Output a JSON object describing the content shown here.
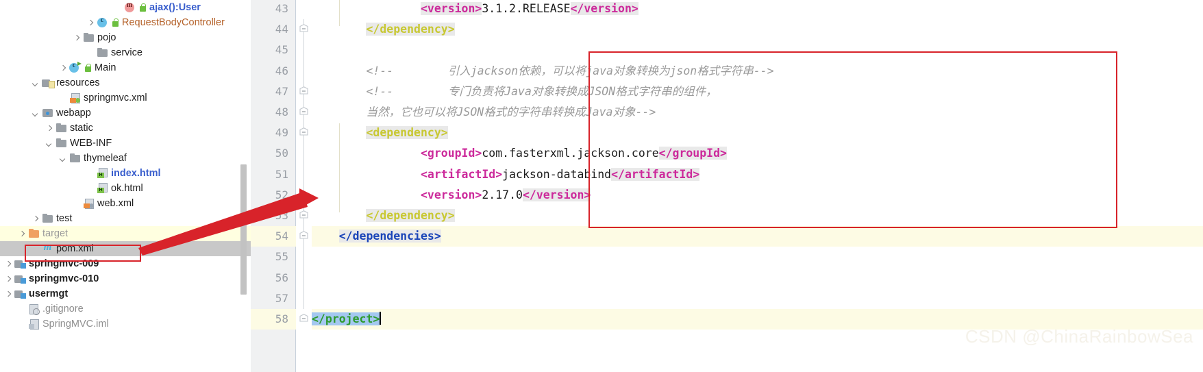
{
  "project_tree": {
    "items": [
      {
        "indent": 9,
        "chevron": "none",
        "icon": "method",
        "lock": true,
        "label": "ajax():User",
        "style": "blue"
      },
      {
        "indent": 7,
        "chevron": "right",
        "icon": "cls",
        "lock": true,
        "label": "RequestBodyController",
        "style": "orange"
      },
      {
        "indent": 6,
        "chevron": "right",
        "icon": "folder",
        "lock": false,
        "label": "pojo",
        "style": "plain"
      },
      {
        "indent": 7,
        "chevron": "none",
        "icon": "folder",
        "lock": false,
        "label": "service",
        "style": "plain"
      },
      {
        "indent": 5,
        "chevron": "right",
        "icon": "clsrun",
        "lock": true,
        "label": "Main",
        "style": "plain"
      },
      {
        "indent": 3,
        "chevron": "down",
        "icon": "folder-res",
        "lock": false,
        "label": "resources",
        "style": "plain"
      },
      {
        "indent": 5,
        "chevron": "none",
        "icon": "xml",
        "lock": false,
        "label": "springmvc.xml",
        "style": "plain"
      },
      {
        "indent": 3,
        "chevron": "down",
        "icon": "webapp",
        "lock": false,
        "label": "webapp",
        "style": "plain"
      },
      {
        "indent": 4,
        "chevron": "right",
        "icon": "folder",
        "lock": false,
        "label": "static",
        "style": "plain"
      },
      {
        "indent": 4,
        "chevron": "down",
        "icon": "folder",
        "lock": false,
        "label": "WEB-INF",
        "style": "plain"
      },
      {
        "indent": 5,
        "chevron": "down",
        "icon": "folder",
        "lock": false,
        "label": "thymeleaf",
        "style": "plain"
      },
      {
        "indent": 7,
        "chevron": "none",
        "icon": "html",
        "lock": false,
        "label": "index.html",
        "style": "blue"
      },
      {
        "indent": 7,
        "chevron": "none",
        "icon": "html",
        "lock": false,
        "label": "ok.html",
        "style": "plain"
      },
      {
        "indent": 6,
        "chevron": "none",
        "icon": "xmlgray",
        "lock": false,
        "label": "web.xml",
        "style": "plain"
      },
      {
        "indent": 3,
        "chevron": "right",
        "icon": "folder",
        "lock": false,
        "label": "test",
        "style": "plain"
      },
      {
        "indent": 2,
        "chevron": "right",
        "icon": "folder-orange",
        "lock": false,
        "label": "target",
        "style": "gray",
        "row_highlight": "yellow"
      },
      {
        "indent": 3,
        "chevron": "none",
        "icon": "maven",
        "lock": false,
        "label": "pom.xml",
        "style": "plain",
        "row_highlight": "gray",
        "boxed": true
      },
      {
        "indent": 1,
        "chevron": "right",
        "icon": "folder-mod",
        "lock": false,
        "label": "springmvc-009",
        "style": "bold"
      },
      {
        "indent": 1,
        "chevron": "right",
        "icon": "folder-mod",
        "lock": false,
        "label": "springmvc-010",
        "style": "bold"
      },
      {
        "indent": 1,
        "chevron": "right",
        "icon": "folder-mod",
        "lock": false,
        "label": "usermgt",
        "style": "bold"
      },
      {
        "indent": 2,
        "chevron": "none",
        "icon": "gitignore",
        "lock": false,
        "label": ".gitignore",
        "style": "dim"
      },
      {
        "indent": 2,
        "chevron": "none",
        "icon": "iml",
        "lock": false,
        "label": "SpringMVC.iml",
        "style": "dim"
      }
    ]
  },
  "editor": {
    "first_line_number": 43,
    "line_numbers": [
      43,
      44,
      45,
      46,
      47,
      48,
      49,
      50,
      51,
      52,
      53,
      54,
      55,
      56,
      57,
      58
    ],
    "highlighted_lines": [
      54,
      58
    ],
    "fold_markers": [
      44,
      47,
      48,
      49,
      53,
      54,
      58
    ],
    "lines": [
      {
        "n": 43,
        "indent": 4,
        "parts": [
          {
            "t": "<version>",
            "c": "tag2 hlbg"
          },
          {
            "t": "3.1.2.RELEASE",
            "c": "txtval"
          },
          {
            "t": "</version>",
            "c": "tag2 hlbg"
          }
        ]
      },
      {
        "n": 44,
        "indent": 2,
        "parts": [
          {
            "t": "</dependency>",
            "c": "tag hlbg"
          }
        ]
      },
      {
        "n": 45,
        "indent": 0,
        "parts": []
      },
      {
        "n": 46,
        "indent": 2,
        "parts": [
          {
            "t": "<!--        引入jackson依赖，可以将java对象转换为json格式字符串-->",
            "c": "comment"
          }
        ]
      },
      {
        "n": 47,
        "indent": 2,
        "parts": [
          {
            "t": "<!--        专门负责将Java对象转换成JSON格式字符串的组件，",
            "c": "comment"
          }
        ]
      },
      {
        "n": 48,
        "indent": 2,
        "parts": [
          {
            "t": "当然，它也可以将JSON格式的字符串转换成Java对象-->",
            "c": "comment"
          }
        ]
      },
      {
        "n": 49,
        "indent": 2,
        "parts": [
          {
            "t": "<dependency>",
            "c": "tag hlbg"
          }
        ]
      },
      {
        "n": 50,
        "indent": 4,
        "parts": [
          {
            "t": "<groupId>",
            "c": "tag2"
          },
          {
            "t": "com.fasterxml.jackson.core",
            "c": "txtval"
          },
          {
            "t": "</groupId>",
            "c": "tag2 hlbg"
          }
        ]
      },
      {
        "n": 51,
        "indent": 4,
        "parts": [
          {
            "t": "<artifactId>",
            "c": "tag2"
          },
          {
            "t": "jackson-databind",
            "c": "txtval"
          },
          {
            "t": "</artifactId>",
            "c": "tag2 hlbg"
          }
        ]
      },
      {
        "n": 52,
        "indent": 4,
        "parts": [
          {
            "t": "<version>",
            "c": "tag2"
          },
          {
            "t": "2.17.0",
            "c": "txtval"
          },
          {
            "t": "</version>",
            "c": "tag2 hlbg"
          }
        ]
      },
      {
        "n": 53,
        "indent": 2,
        "parts": [
          {
            "t": "</dependency>",
            "c": "tag hlbg"
          }
        ]
      },
      {
        "n": 54,
        "indent": 1,
        "parts": [
          {
            "t": "</dependencies>",
            "c": "blue hlbg"
          }
        ]
      },
      {
        "n": 55,
        "indent": 0,
        "parts": []
      },
      {
        "n": 56,
        "indent": 0,
        "parts": []
      },
      {
        "n": 57,
        "indent": 0,
        "parts": []
      },
      {
        "n": 58,
        "indent": 0,
        "parts": [
          {
            "t": "</project>",
            "c": "green sel"
          },
          {
            "t": "",
            "c": "caret"
          }
        ]
      }
    ]
  },
  "annotations": {
    "red_box_editor_label": "jackson dependency block highlight",
    "red_box_tree_label": "pom.xml highlight",
    "arrow_label": "arrow from pom.xml to jackson dependency block"
  },
  "watermark": {
    "text": "CSDN @ChinaRainbowSea"
  },
  "colors": {
    "annotation_red": "#d8232a",
    "selection_blue": "#a4c8f0",
    "row_highlight_yellow": "#ffffe0",
    "row_highlight_gray": "#c8c8c8",
    "line_highlight": "#fdfbe4",
    "gutter_bg": "#f0f1f2",
    "tag_olive": "#c8c832",
    "tag_magenta": "#cc2a9b",
    "tag_blue": "#1a44b8",
    "tag_green": "#2e9b2e",
    "comment_gray": "#9a9a9a"
  }
}
